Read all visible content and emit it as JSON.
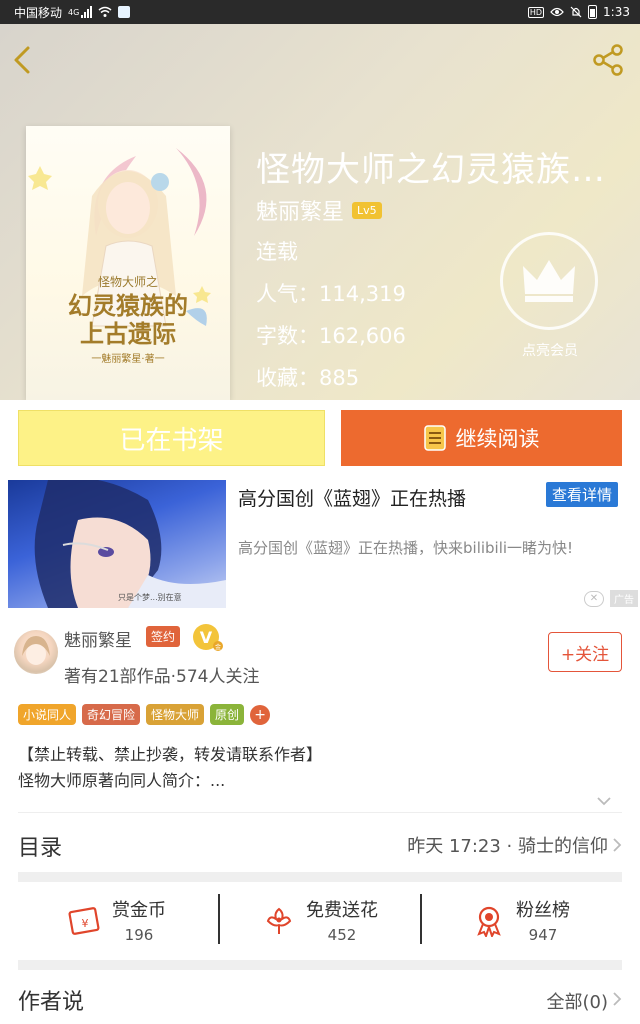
{
  "status_bar": {
    "carrier": "中国移动",
    "network": "4G",
    "time": "1:33",
    "hd": "HD"
  },
  "book": {
    "title": "怪物大师之幻灵猿族的...",
    "author": "魅丽繁星",
    "author_level": "Lv5",
    "status": "连载",
    "popularity": "人气：114,319",
    "word_count": "字数：162,606",
    "favorites": "收藏：885",
    "cover_title_line1": "怪物大师之",
    "cover_title_line2": "幻灵猿族的",
    "cover_title_line3": "上古遗际",
    "cover_author": "一魅丽繁星·著一"
  },
  "vip": {
    "label": "点亮会员"
  },
  "actions": {
    "shelf_label": "已在书架",
    "read_label": "继续阅读"
  },
  "ad": {
    "title": "高分国创《蓝翅》正在热播",
    "detail_label": "查看详情",
    "description": "高分国创《蓝翅》正在热播，快来bilibili一睹为快!",
    "image_caption": "只是个梦...别在意",
    "close": "✕",
    "tag": "广告"
  },
  "author": {
    "name": "魅丽繁星",
    "sign_badge": "签约",
    "v_badge": "V",
    "v_sub": "金",
    "stats": "著有21部作品·574人关注",
    "follow_label": "+关注"
  },
  "tags": [
    {
      "label": "小说同人",
      "color": "#f0a52b"
    },
    {
      "label": "奇幻冒险",
      "color": "#d76a4a"
    },
    {
      "label": "怪物大师",
      "color": "#d9a236"
    },
    {
      "label": "原创",
      "color": "#8bb43a"
    }
  ],
  "tag_add": "+",
  "intro": {
    "line1": "【禁止转载、禁止抄袭，转发请联系作者】",
    "line2": "怪物大师原著向同人简介：..."
  },
  "catalog": {
    "label": "目录",
    "latest": "昨天 17:23 · 骑士的信仰"
  },
  "stats": [
    {
      "label": "赏金币",
      "value": "196",
      "icon": "coin-envelope-icon"
    },
    {
      "label": "免费送花",
      "value": "452",
      "icon": "flower-icon"
    },
    {
      "label": "粉丝榜",
      "value": "947",
      "icon": "medal-icon"
    }
  ],
  "author_says": {
    "label": "作者说",
    "all": "全部(0)"
  },
  "colors": {
    "accent_orange": "#ed6a2f",
    "shelf_yellow": "#fdf287",
    "follow_red": "#e4553a",
    "detail_blue": "#2a79d6"
  }
}
